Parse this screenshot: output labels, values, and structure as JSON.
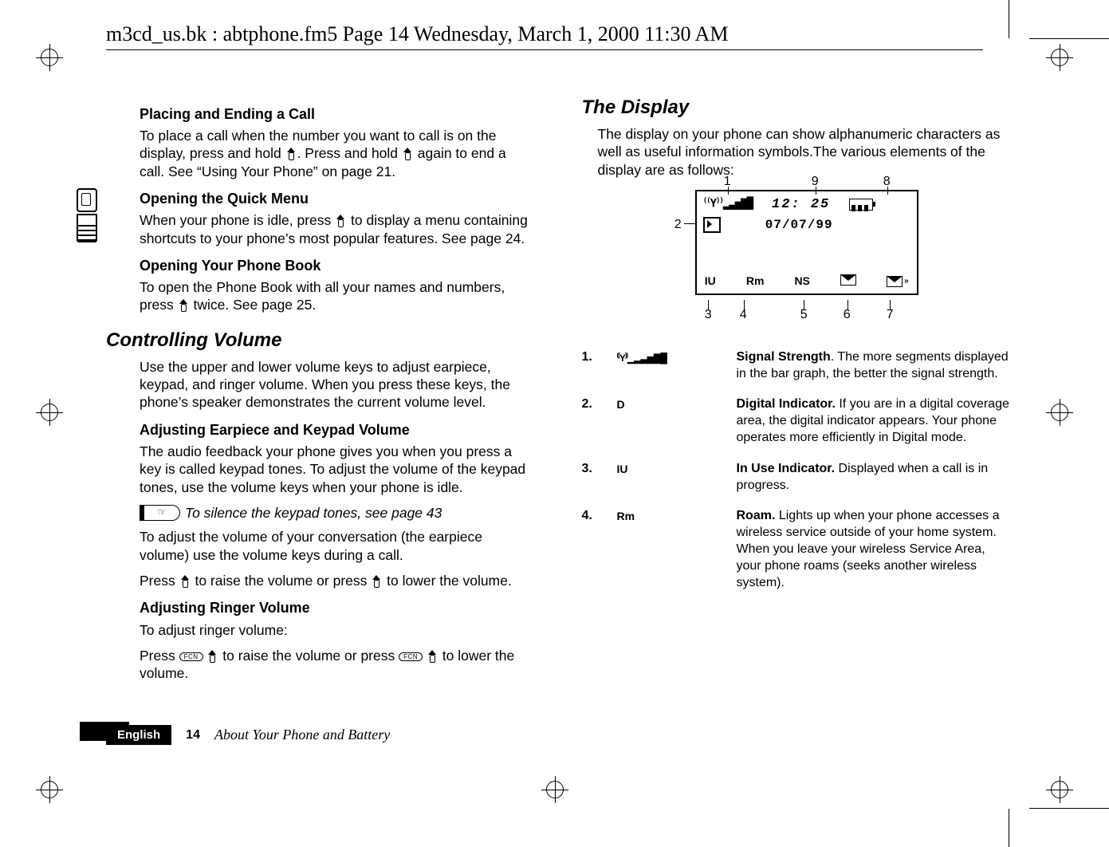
{
  "running_head": "m3cd_us.bk : abtphone.fm5  Page 14  Wednesday, March 1, 2000  11:30 AM",
  "left": {
    "h_placing": "Placing and Ending a Call",
    "p_placing": "To place a call when the number you want to call is on the display, press and hold N. Press and hold N again to end a call. See “Using Your Phone” on page 21.",
    "h_quick": "Opening the Quick Menu",
    "p_quick": "When your phone is idle, press N to display a menu containing shortcuts to your phone’s most popular features. See page 24.",
    "h_book": "Opening Your Phone Book",
    "p_book": "To open the Phone Book with all your names and numbers, press N twice. See page 25.",
    "h_volume": "Controlling Volume",
    "p_volume": "Use the upper and lower volume keys to adjust earpiece, keypad, and ringer volume. When you press these keys, the phone’s speaker demonstrates the current volume level.",
    "h_ek": "Adjusting Earpiece and Keypad Volume",
    "p_ek1": "The audio feedback your phone gives you when you press a key is called keypad tones. To adjust the volume of the keypad tones, use the volume keys when your phone is idle.",
    "tip": "To silence the keypad tones, see page 43",
    "p_ek2": "To adjust the volume of your conversation (the earpiece volume) use the volume keys during a call.",
    "p_ek3a": "Press ",
    "p_ek3b": " to raise the volume or press ",
    "p_ek3c": " to lower the volume.",
    "h_ring": "Adjusting Ringer Volume",
    "p_ring1": "To adjust ringer volume:",
    "p_ring2a": "Press ",
    "p_ring2b": " to raise the volume or ",
    "p_ring2c": "press ",
    "p_ring2d": " to lower the volume.",
    "fcn": "FCN"
  },
  "right": {
    "h_display": "The Display",
    "p_display": "The display on your phone can show alphanumeric characters as well as useful information symbols.The various elements of the display are as follows:",
    "fig": {
      "clock": "12: 25",
      "date": "07/07/99",
      "row3": [
        "IU",
        "Rm",
        "NS"
      ],
      "callouts": {
        "c1": "1",
        "c2": "2",
        "c3": "3",
        "c4": "4",
        "c5": "5",
        "c6": "6",
        "c7": "7",
        "c8": "8",
        "c9": "9"
      }
    },
    "legend": [
      {
        "num": "1.",
        "sym": "signal",
        "title": "Signal Strength",
        "rest": ". The more segments displayed in the bar graph, the better the signal strength."
      },
      {
        "num": "2.",
        "sym": "D",
        "title": "Digital Indicator.",
        "rest": " If you are in a digital coverage area, the digital indicator appears. Your phone operates more efficiently in Digital mode."
      },
      {
        "num": "3.",
        "sym": "IU",
        "title": "In Use Indicator.",
        "rest": " Displayed when a call is in progress."
      },
      {
        "num": "4.",
        "sym": "Rm",
        "title": "Roam.",
        "rest": " Lights up when your phone accesses a wireless service outside of your home system. When you leave your wireless Service Area, your phone roams (seeks another wireless system)."
      }
    ]
  },
  "footer": {
    "lang": "English",
    "page": "14",
    "section": "About Your Phone and Battery"
  }
}
